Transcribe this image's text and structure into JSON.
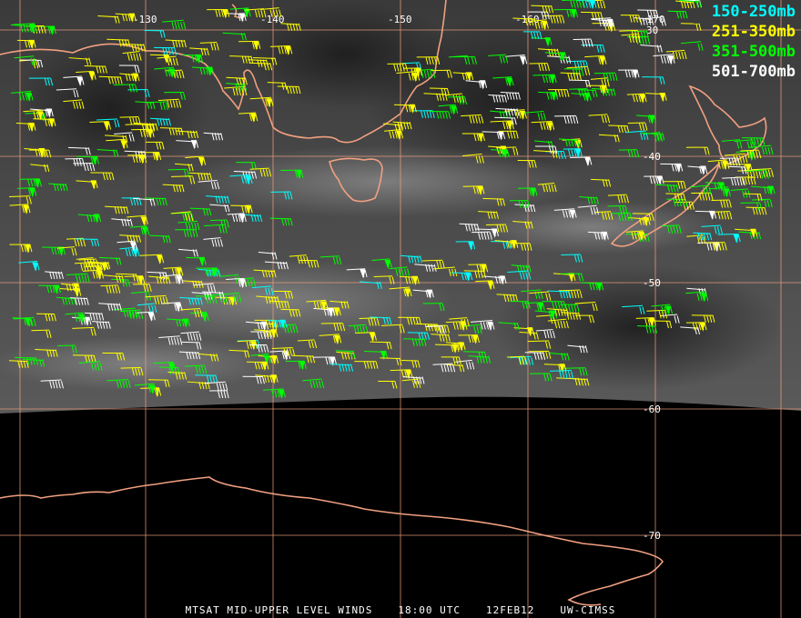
{
  "legend": [
    {
      "label": "150-250mb",
      "color": "#00ffff"
    },
    {
      "label": "251-350mb",
      "color": "#ffff00"
    },
    {
      "label": "351-500mb",
      "color": "#00ff00"
    },
    {
      "label": "501-700mb",
      "color": "#ffffff"
    }
  ],
  "longitude_labels": [
    "-130",
    "-140",
    "-150",
    "-160",
    "-170"
  ],
  "latitude_labels": [
    "30",
    "-40",
    "-50",
    "-60",
    "-70"
  ],
  "footer": {
    "product": "MTSAT MID-UPPER LEVEL WINDS",
    "time": "18:00 UTC",
    "date": "12FEB12",
    "source": "UW-CIMSS"
  },
  "colors": {
    "grid": "#f0a080",
    "coastline": "#f0a080",
    "background": "#000000"
  }
}
